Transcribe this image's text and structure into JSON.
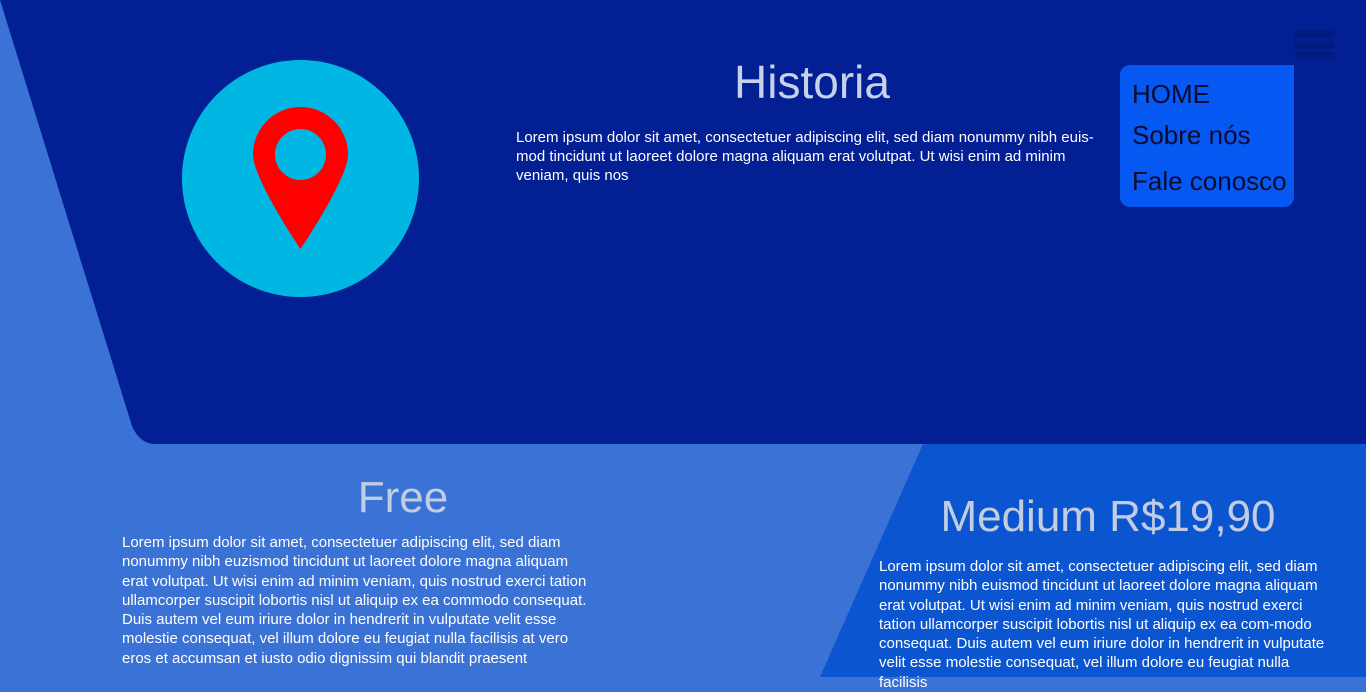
{
  "hero": {
    "title": "Historia",
    "text": "Lorem ipsum dolor sit amet, consectetuer adipiscing elit, sed diam nonummy nibh euis-mod tincidunt ut laoreet dolore magna aliquam erat volutpat. Ut wisi enim ad minim veniam, quis nos",
    "icon": "map-pin-icon"
  },
  "nav": {
    "menu_icon": "hamburger-menu-icon",
    "items": [
      {
        "label": "HOME"
      },
      {
        "label": "Sobre nós"
      },
      {
        "label": "Fale conosco"
      }
    ]
  },
  "plans": [
    {
      "title": "Free",
      "text": "Lorem ipsum dolor sit amet, consectetuer adipiscing elit, sed diam nonummy nibh euzismod tincidunt ut laoreet dolore magna aliquam erat volutpat. Ut wisi enim ad minim veniam, quis nostrud exerci tation ullamcorper suscipit lobortis nisl ut aliquip ex ea commodo consequat. Duis autem vel eum iriure dolor in hendrerit in vulputate velit esse molestie consequat, vel illum dolore eu feugiat nulla facilisis at vero eros et accumsan et iusto odio dignissim qui blandit praesent"
    },
    {
      "title": "Medium R$19,90",
      "text": "Lorem ipsum dolor sit amet, consectetuer adipiscing elit, sed diam nonummy nibh euismod tincidunt ut laoreet dolore magna aliquam erat volutpat. Ut wisi enim ad minim veniam, quis nostrud exerci tation ullamcorper suscipit lobortis nisl ut aliquip ex ea com-modo consequat. Duis autem vel eum iriure dolor in hendrerit in vulputate velit esse molestie consequat, vel illum dolore eu feugiat nulla facilisis"
    }
  ],
  "colors": {
    "page_background": "#3a72d6",
    "hero_background": "#021f93",
    "medium_panel": "#0b55d0",
    "dropdown": "#0558f1",
    "badge": "#00b7e3",
    "pin": "#ff0000"
  }
}
